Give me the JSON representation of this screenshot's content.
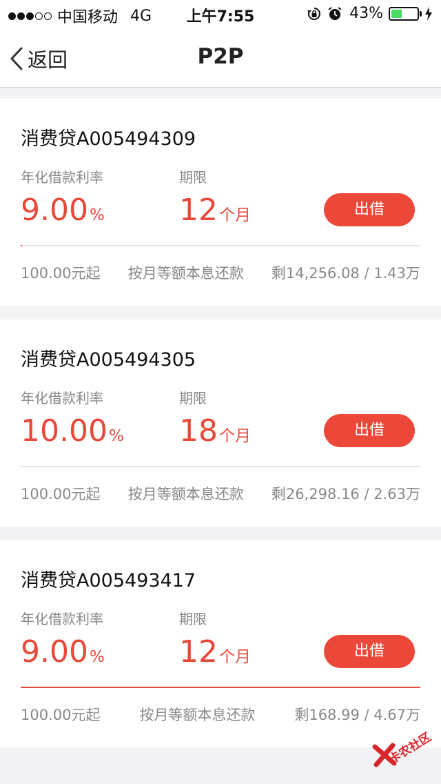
{
  "status_bar": {
    "carrier": "中国移动",
    "network": "4G",
    "time": "上午7:55",
    "battery": "43%",
    "battery_level": 0.43,
    "signal_full": 3,
    "signal_total": 5,
    "battery_color": "#4cd964"
  },
  "nav": {
    "back_label": "返回",
    "title": "P2P"
  },
  "loans": [
    {
      "name": "消费贷A005494309",
      "rate_label": "年化借款利率",
      "rate_value": "9.00",
      "rate_unit": "%",
      "term_label": "期限",
      "term_value": "12",
      "term_unit": "个月",
      "button": "出借",
      "progress": 0.003,
      "min": "100.00元起",
      "method": "按月等额本息还款",
      "remaining": "剩14,256.08 / 1.43万"
    },
    {
      "name": "消费贷A005494305",
      "rate_label": "年化借款利率",
      "rate_value": "10.00",
      "rate_unit": "%",
      "term_label": "期限",
      "term_value": "18",
      "term_unit": "个月",
      "button": "出借",
      "progress": 0.0,
      "min": "100.00元起",
      "method": "按月等额本息还款",
      "remaining": "剩26,298.16 / 2.63万"
    },
    {
      "name": "消费贷A005493417",
      "rate_label": "年化借款利率",
      "rate_value": "9.00",
      "rate_unit": "%",
      "term_label": "期限",
      "term_value": "12",
      "term_unit": "个月",
      "button": "出借",
      "progress": 1.0,
      "min": "100.00元起",
      "method": "按月等额本息还款",
      "remaining": "剩168.99 / 4.67万"
    }
  ],
  "watermark": {
    "text": "卡农社区"
  },
  "colors": {
    "accent": "#e8483a",
    "button": "#ec4839"
  }
}
